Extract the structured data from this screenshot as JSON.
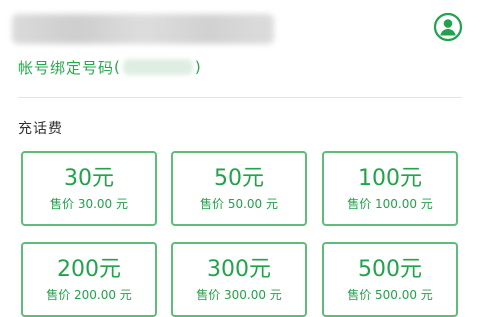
{
  "header": {
    "avatar_icon": "user-avatar-icon"
  },
  "bind": {
    "label": "帐号绑定号码",
    "open_paren": "(",
    "close_paren": ")"
  },
  "section": {
    "title": "充话费"
  },
  "options": [
    {
      "amount": "30元",
      "price": "售价 30.00 元"
    },
    {
      "amount": "50元",
      "price": "售价 50.00 元"
    },
    {
      "amount": "100元",
      "price": "售价 100.00 元"
    },
    {
      "amount": "200元",
      "price": "售价 200.00 元"
    },
    {
      "amount": "300元",
      "price": "售价 300.00 元"
    },
    {
      "amount": "500元",
      "price": "售价 500.00 元"
    }
  ],
  "colors": {
    "accent": "#22a24a",
    "border": "#5dbd79"
  }
}
